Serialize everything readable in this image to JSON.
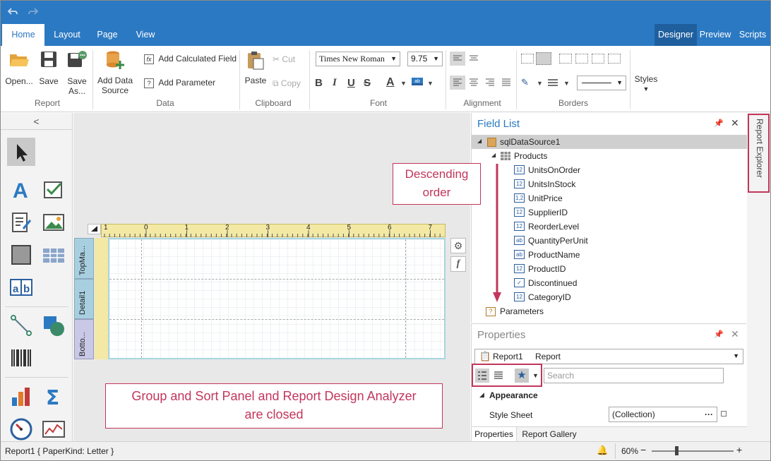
{
  "quick_access": {
    "undo": "undo-icon",
    "redo": "redo-icon"
  },
  "tabs": {
    "home": "Home",
    "layout": "Layout",
    "page": "Page",
    "view": "View",
    "designer": "Designer",
    "preview": "Preview",
    "scripts": "Scripts"
  },
  "ribbon": {
    "report_group": {
      "open": "Open...",
      "save": "Save",
      "save_as_line1": "Save",
      "save_as_line2": "As...",
      "label": "Report"
    },
    "data_group": {
      "add_data_source_line1": "Add Data",
      "add_data_source_line2": "Source",
      "add_calculated_field": "Add Calculated Field",
      "add_parameter": "Add Parameter",
      "label": "Data"
    },
    "clipboard_group": {
      "paste": "Paste",
      "cut": "Cut",
      "copy": "Copy",
      "label": "Clipboard"
    },
    "font_group": {
      "font_name": "Times New Roman",
      "font_size": "9.75",
      "bold": "B",
      "italic": "I",
      "underline": "U",
      "strike": "S",
      "fore": "A",
      "label": "Font"
    },
    "alignment_group": {
      "label": "Alignment"
    },
    "borders_group": {
      "label": "Borders"
    },
    "styles_group": {
      "styles": "Styles"
    }
  },
  "toolbox": {
    "collapse": "<"
  },
  "designer": {
    "ruler_numbers": [
      "0",
      "1",
      "2",
      "3",
      "4",
      "5",
      "6",
      "7"
    ],
    "bands": {
      "top_margin": "TopMa...",
      "detail": "Detail1",
      "bottom_margin": "Botto..."
    },
    "fx_button": "f"
  },
  "field_list": {
    "title": "Field List",
    "datasource": "sqlDataSource1",
    "table": "Products",
    "fields": [
      {
        "name": "UnitsOnOrder",
        "type": "12"
      },
      {
        "name": "UnitsInStock",
        "type": "12"
      },
      {
        "name": "UnitPrice",
        "type": "1,2"
      },
      {
        "name": "SupplierID",
        "type": "12"
      },
      {
        "name": "ReorderLevel",
        "type": "12"
      },
      {
        "name": "QuantityPerUnit",
        "type": "ab"
      },
      {
        "name": "ProductName",
        "type": "ab"
      },
      {
        "name": "ProductID",
        "type": "12"
      },
      {
        "name": "Discontinued",
        "type": "✓"
      },
      {
        "name": "CategoryID",
        "type": "12"
      }
    ],
    "parameters": "Parameters",
    "parameters_icon": "?"
  },
  "properties": {
    "title": "Properties",
    "selected_name": "Report1",
    "selected_type": "Report",
    "search_placeholder": "Search",
    "category": "Appearance",
    "row_label": "Style Sheet",
    "row_value": "(Collection)",
    "row_ellipsis": "···",
    "tabs": {
      "properties": "Properties",
      "gallery": "Report Gallery"
    }
  },
  "report_explorer": {
    "label": "Report Explorer"
  },
  "callouts": {
    "descending_line1": "Descending",
    "descending_line2": "order",
    "closed_line1": "Group and Sort Panel and Report Design Analyzer",
    "closed_line2": "are closed"
  },
  "status": {
    "text": "Report1 { PaperKind: Letter }",
    "zoom": "60%",
    "zoom_minus": "−",
    "zoom_plus": "+",
    "zoom_level": 0.3
  },
  "colors": {
    "accent": "#2b79c2",
    "callout": "#c2365b",
    "band": "#a8cfe0",
    "ruler": "#f3e9a5"
  }
}
